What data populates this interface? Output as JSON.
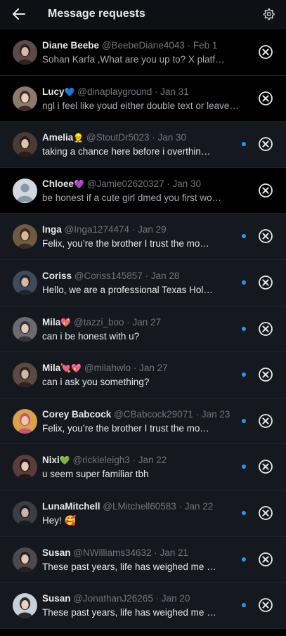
{
  "header": {
    "title": "Message requests",
    "back_icon": "arrow-left-icon",
    "settings_icon": "gear-icon"
  },
  "colors": {
    "background": "#000000",
    "unread_row": "#15181e",
    "accent_dot": "#1d9bf0",
    "muted_text": "#71767b"
  },
  "requests": [
    {
      "name": "Diane Beebe",
      "badge": "",
      "handle": "@BeebeDiane4043",
      "date": "Feb 1",
      "preview": "Sohan Karfa ,What are you up to? X platf…",
      "unread": false,
      "avatar": "photo"
    },
    {
      "name": "Lucy",
      "badge": "💙",
      "handle": "@dinaplayground",
      "date": "Jan 31",
      "preview": "ngl i feel like youd either double text or leave …",
      "unread": false,
      "avatar": "photo"
    },
    {
      "name": "Amelia",
      "badge": "👷",
      "handle": "@StoutDr5023",
      "date": "Jan 30",
      "preview": "taking a chance here before i overthin…",
      "unread": true,
      "avatar": "photo"
    },
    {
      "name": "Chloee",
      "badge": "💜",
      "handle": "@Jamie02620327",
      "date": "Jan 30",
      "preview": "be honest if a cute girl dmed you first wo…",
      "unread": false,
      "avatar": "default"
    },
    {
      "name": "Inga",
      "badge": "",
      "handle": "@Inga1274474",
      "date": "Jan 29",
      "preview": "Felix, you’re the brother I trust the mo…",
      "unread": true,
      "avatar": "photo"
    },
    {
      "name": "Coriss",
      "badge": "",
      "handle": "@Coriss145857",
      "date": "Jan 28",
      "preview": "Hello, we are a professional Texas Hol…",
      "unread": true,
      "avatar": "photo"
    },
    {
      "name": "Mila",
      "badge": "💖",
      "handle": "@tazzi_boo",
      "date": "Jan 27",
      "preview": "can i be honest with u?",
      "unread": true,
      "avatar": "photo"
    },
    {
      "name": "Mila",
      "badge": "💘💖",
      "handle": "@milahwlo",
      "date": "Jan 27",
      "preview": "can i ask you something?",
      "unread": true,
      "avatar": "photo"
    },
    {
      "name": "Corey Babcock",
      "badge": "",
      "handle": "@CBabcock29071",
      "date": "Jan 23",
      "preview": "Felix, you’re the brother I trust the mo…",
      "unread": true,
      "avatar": "photo"
    },
    {
      "name": "Nixi",
      "badge": "💚",
      "handle": "@rickieleigh3",
      "date": "Jan 22",
      "preview": "u seem super familiar tbh",
      "unread": true,
      "avatar": "photo"
    },
    {
      "name": "LunaMitchell",
      "badge": "",
      "handle": "@LMitchell60583",
      "date": "Jan 22",
      "preview": "Hey!   🥰",
      "unread": true,
      "avatar": "photo"
    },
    {
      "name": "Susan",
      "badge": "",
      "handle": "@NWilliams34632",
      "date": "Jan 21",
      "preview": "These past years, life has weighed me …",
      "unread": true,
      "avatar": "photo"
    },
    {
      "name": "Susan",
      "badge": "",
      "handle": "@JonathanJ26265",
      "date": "Jan 20",
      "preview": "These past years, life has weighed me …",
      "unread": true,
      "avatar": "photo"
    }
  ],
  "row_icons": {
    "close": "close-circle-icon",
    "unread": "unread-dot"
  }
}
